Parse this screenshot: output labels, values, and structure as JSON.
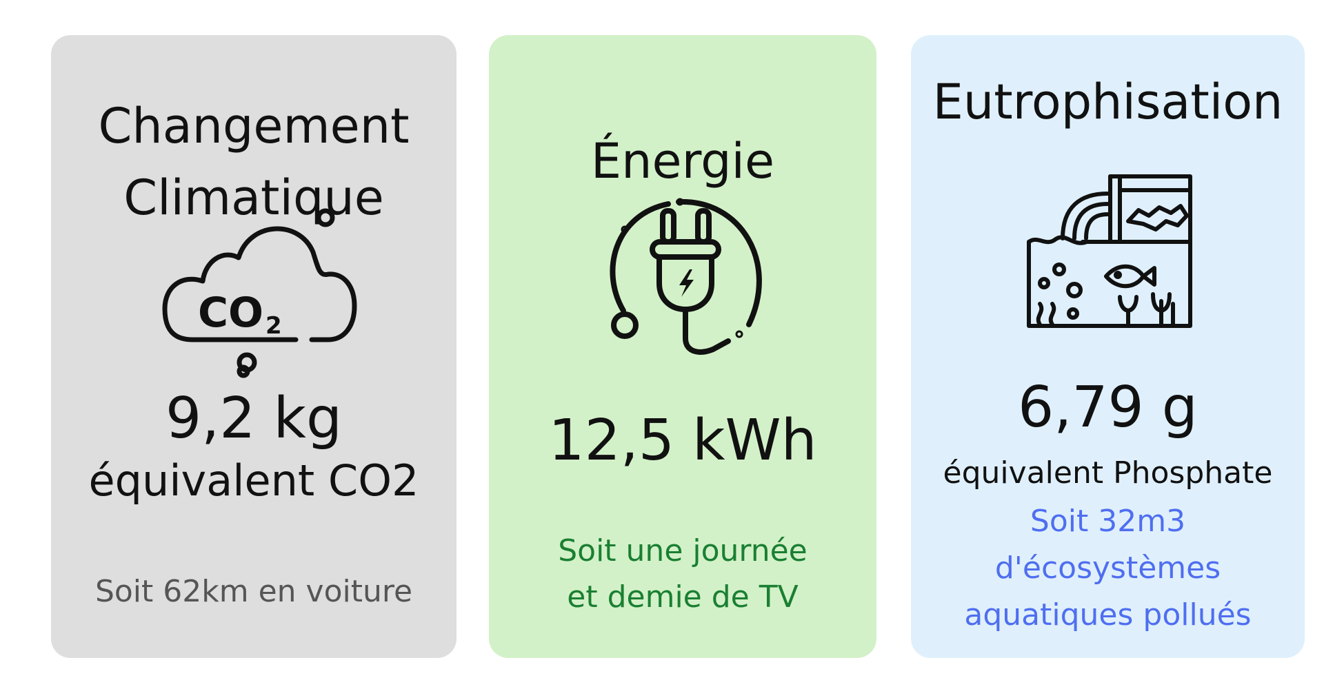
{
  "cards": [
    {
      "id": "climate",
      "title_line1": "Changement",
      "title_line2": "Climatique",
      "value": "9,2 kg",
      "unit": "équivalent CO2",
      "note": "Soit 62km en voiture",
      "icon": "co2-cloud-icon",
      "icon_text": "CO",
      "icon_subscript": "2",
      "background": "#dedede",
      "note_color": "#555555"
    },
    {
      "id": "energy",
      "title": "Énergie",
      "value": "12,5 kWh",
      "note_line1": "Soit une journée",
      "note_line2": "et demie de TV",
      "icon": "power-plug-icon",
      "background": "#d3f1c8",
      "note_color": "#1a7f32"
    },
    {
      "id": "eutro",
      "title": "Eutrophisation",
      "value": "6,79 g",
      "unit": "équivalent Phosphate",
      "note_line1": "Soit 32m3",
      "note_line2": "d'écosystèmes",
      "note_line3": "aquatiques pollués",
      "icon": "polluted-water-icon",
      "background": "#dff0fc",
      "note_color": "#4f6ef0"
    }
  ]
}
